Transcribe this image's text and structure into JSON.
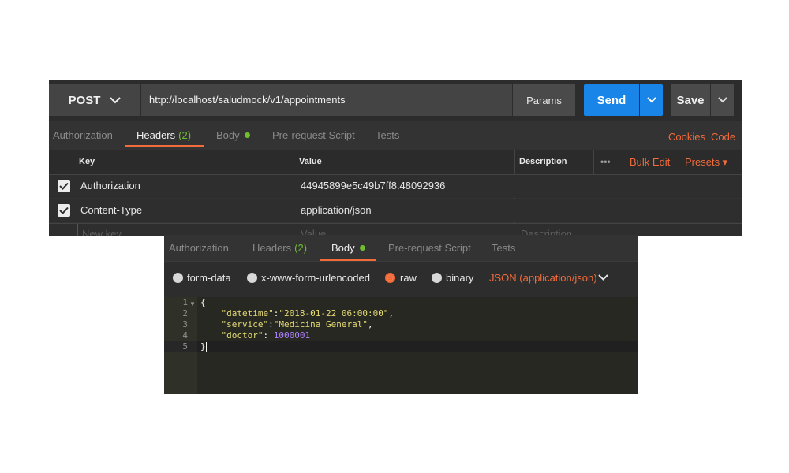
{
  "request": {
    "method": "POST",
    "url": "http://localhost/saludmock/v1/appointments",
    "params_label": "Params",
    "send_label": "Send",
    "save_label": "Save"
  },
  "tabs": {
    "authorization": "Authorization",
    "headers": "Headers",
    "headers_count": "(2)",
    "body": "Body",
    "prerequest": "Pre-request Script",
    "tests": "Tests"
  },
  "links": {
    "cookies": "Cookies",
    "code": "Code"
  },
  "headers_table": {
    "columns": {
      "key": "Key",
      "value": "Value",
      "description": "Description"
    },
    "more": "•••",
    "bulk_edit": "Bulk Edit",
    "presets": "Presets ▾",
    "rows": [
      {
        "key": "Authorization",
        "value": "44945899e5c49b7ff8.48092936",
        "checked": true
      },
      {
        "key": "Content-Type",
        "value": "application/json",
        "checked": true
      }
    ],
    "placeholders": {
      "key": "New key",
      "value": "Value",
      "description": "Description"
    }
  },
  "body": {
    "options": [
      "form-data",
      "x-www-form-urlencoded",
      "raw",
      "binary"
    ],
    "selected": "raw",
    "content_type": "JSON (application/json)",
    "editor": {
      "line_numbers": [
        "1",
        "2",
        "3",
        "4",
        "5"
      ],
      "fields": [
        {
          "key": "\"datetime\"",
          "sep": ":",
          "value": "\"2018-01-22 06:00:00\"",
          "trail": ","
        },
        {
          "key": "\"service\"",
          "sep": ":",
          "value": "\"Medicina General\"",
          "trail": ","
        },
        {
          "key": "\"doctor\"",
          "sep": ": ",
          "value": "1000001",
          "trail": ""
        }
      ],
      "open_brace": "{",
      "close_brace": "}"
    }
  },
  "colors": {
    "accent": "#f26b3a",
    "send": "#1a85e8",
    "status_green": "#6fbe2e"
  }
}
